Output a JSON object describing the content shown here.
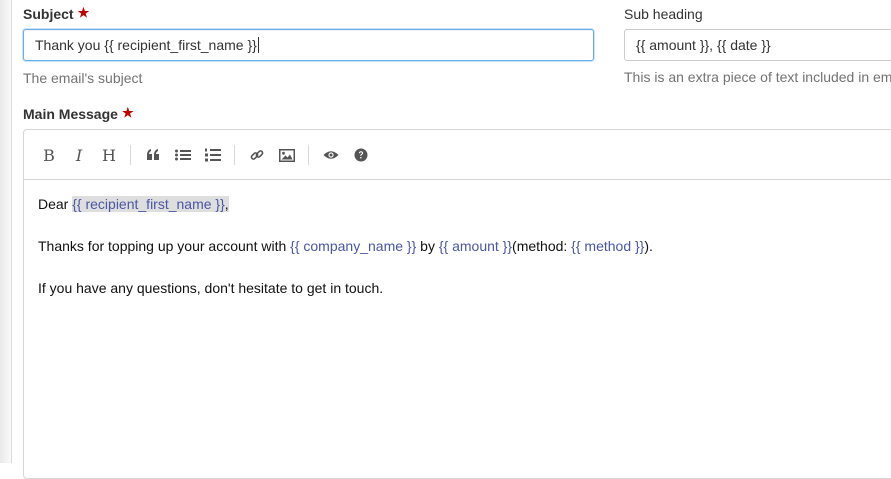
{
  "subject": {
    "label": "Subject",
    "required_mark": "★",
    "value": "Thank you  {{ recipient_first_name }}",
    "help": "The email's subject"
  },
  "subheading": {
    "label": "Sub heading",
    "value": "{{ amount }}, {{ date }}",
    "help": "This is an extra piece of text included in em"
  },
  "main_message": {
    "label": "Main Message",
    "required_mark": "★",
    "toolbar": [
      "bold-icon",
      "italic-icon",
      "heading-icon",
      "quote-icon",
      "unordered-list-icon",
      "ordered-list-icon",
      "link-icon",
      "image-icon",
      "preview-icon",
      "help-icon"
    ],
    "para1": {
      "t1": "Dear ",
      "v1": "{{ recipient_first_name }}",
      "t2": ","
    },
    "para2": {
      "t1": "Thanks for topping up your account with ",
      "v1": "{{ company_name }}",
      "t2": " by ",
      "v2": "{{ amount }}",
      "t3": "(method: ",
      "v3": "{{ method }}",
      "t4": ")."
    },
    "para3": "If you have any questions, don't hesitate to get in touch."
  },
  "colors": {
    "accent_focus": "#66afe9",
    "required": "#c00000",
    "variable": "#4a56a6",
    "help_text": "#737373"
  }
}
